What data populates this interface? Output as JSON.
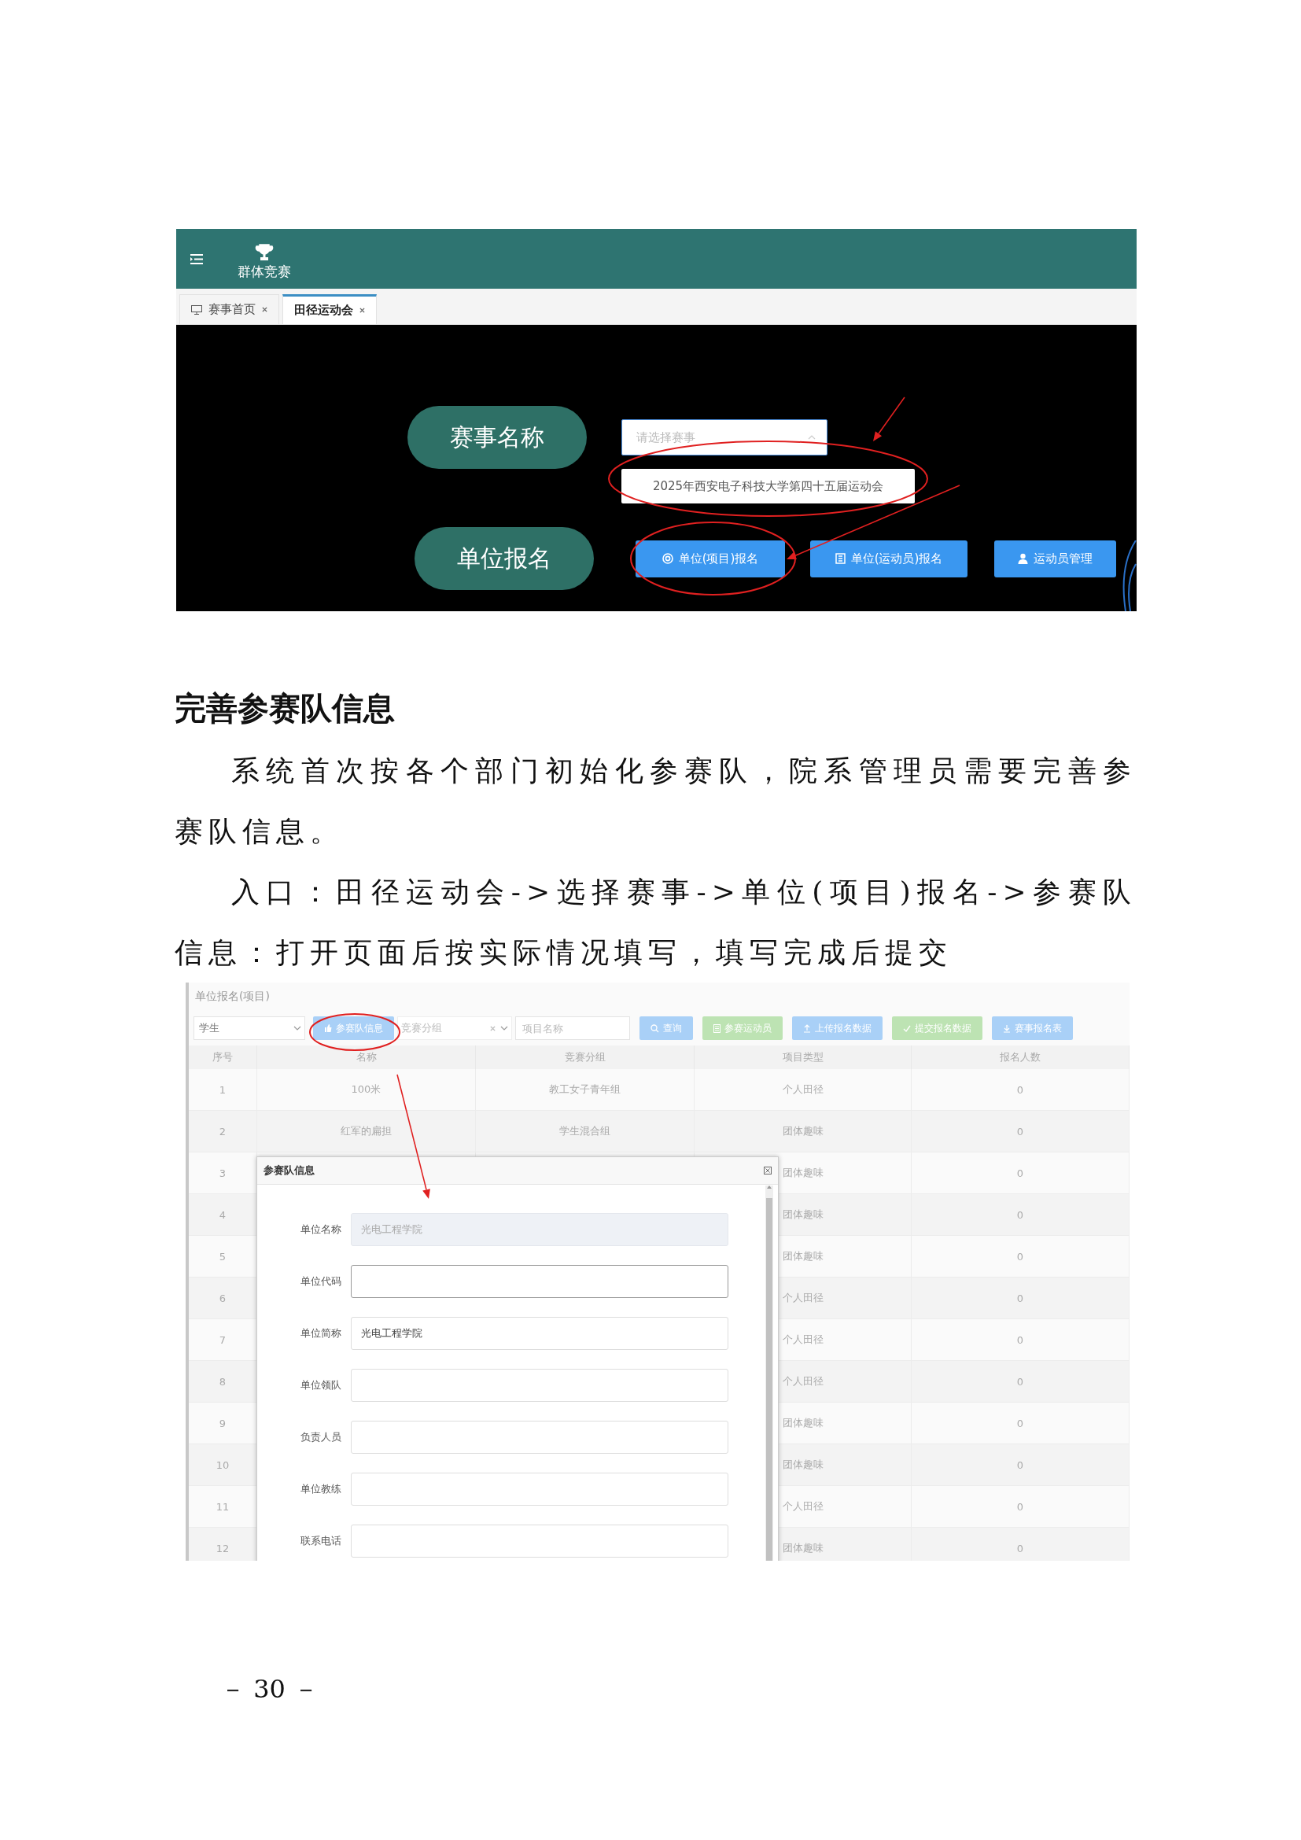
{
  "top_screenshot": {
    "app_title": "群体竞赛",
    "tabs": [
      {
        "label": "赛事首页",
        "selected": false
      },
      {
        "label": "田径运动会",
        "selected": true
      }
    ],
    "event_label": "赛事名称",
    "event_select": {
      "placeholder": "请选择赛事"
    },
    "event_options": [
      "2025年西安电子科技大学第四十五届运动会"
    ],
    "register_label": "单位报名",
    "buttons": [
      "单位(项目)报名",
      "单位(运动员)报名",
      "运动员管理"
    ]
  },
  "heading": "完善参赛队信息",
  "paragraphs": [
    "系统首次按各个部门初始化参赛队，院系管理员需要完善参赛队信息。",
    "入口：田径运动会->选择赛事->单位(项目)报名->参赛队信息：打开页面后按实际情况填写，填写完成后提交"
  ],
  "bottom_screenshot": {
    "panel_title": "单位报名(项目)",
    "filter_select": {
      "value": "学生"
    },
    "team_button": "参赛队信息",
    "group_select": {
      "placeholder": "竞赛分组"
    },
    "name_input": {
      "placeholder": "项目名称"
    },
    "buttons": [
      {
        "label": "查询",
        "kind": "primary"
      },
      {
        "label": "参赛运动员",
        "kind": "success"
      },
      {
        "label": "上传报名数据",
        "kind": "primary"
      },
      {
        "label": "提交报名数据",
        "kind": "success"
      },
      {
        "label": "赛事报名表",
        "kind": "primary"
      }
    ],
    "table": {
      "columns": [
        "序号",
        "名称",
        "竞赛分组",
        "项目类型",
        "报名人数"
      ],
      "rows": [
        {
          "index": "1",
          "name": "100米",
          "group": "教工女子青年组",
          "type": "个人田径",
          "count": "0"
        },
        {
          "index": "2",
          "name": "红军的扁担",
          "group": "学生混合组",
          "type": "团体趣味",
          "count": "0"
        },
        {
          "index": "3",
          "type": "团体趣味",
          "count": "0"
        },
        {
          "index": "4",
          "type": "团体趣味",
          "count": "0"
        },
        {
          "index": "5",
          "type": "团体趣味",
          "count": "0"
        },
        {
          "index": "6",
          "type": "个人田径",
          "count": "0"
        },
        {
          "index": "7",
          "type": "个人田径",
          "count": "0"
        },
        {
          "index": "8",
          "type": "个人田径",
          "count": "0"
        },
        {
          "index": "9",
          "type": "团体趣味",
          "count": "0"
        },
        {
          "index": "10",
          "type": "团体趣味",
          "count": "0"
        },
        {
          "index": "11",
          "type": "个人田径",
          "count": "0"
        },
        {
          "index": "12",
          "type": "团体趣味",
          "count": "0"
        }
      ]
    },
    "dialog": {
      "title": "参赛队信息",
      "fields": [
        {
          "label": "单位名称",
          "value": "光电工程学院",
          "disabled": true,
          "focused": false
        },
        {
          "label": "单位代码",
          "disabled": false,
          "focused": true
        },
        {
          "label": "单位简称",
          "value": "光电工程学院",
          "disabled": false,
          "focused": false
        },
        {
          "label": "单位领队",
          "disabled": false,
          "focused": false
        },
        {
          "label": "负责人员",
          "disabled": false,
          "focused": false
        },
        {
          "label": "单位教练",
          "disabled": false,
          "focused": false
        },
        {
          "label": "联系电话",
          "disabled": false,
          "focused": false
        }
      ]
    }
  },
  "page_number": "－ 30 －"
}
